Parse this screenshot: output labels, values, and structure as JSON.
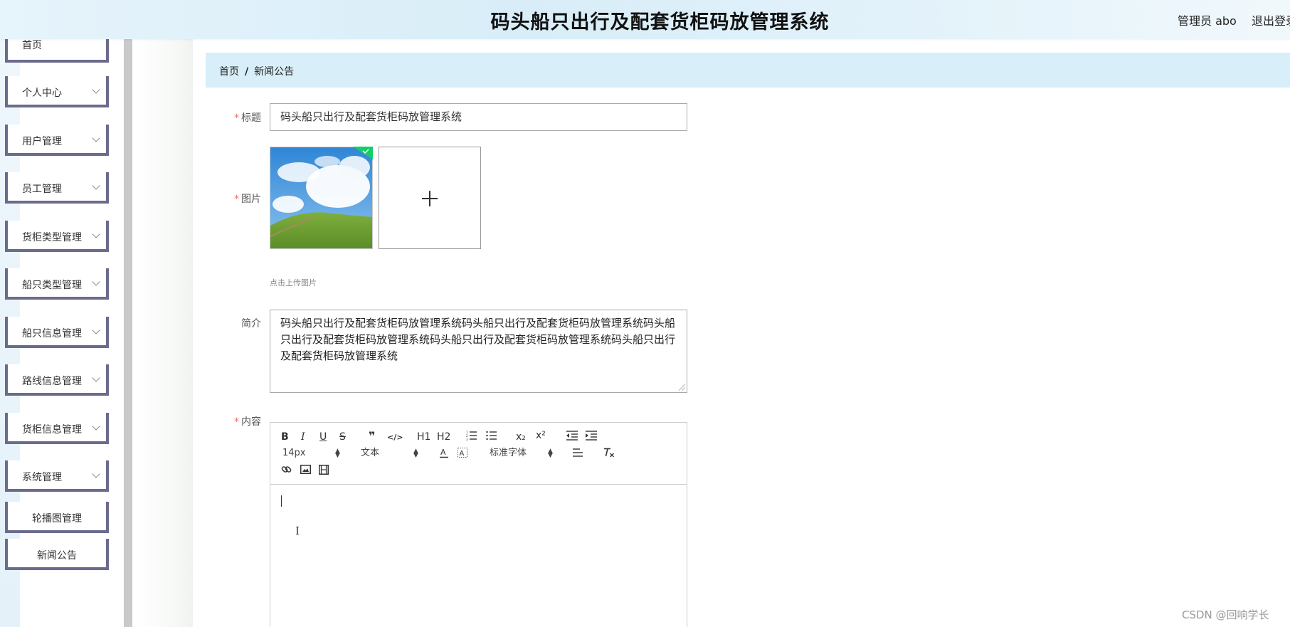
{
  "header": {
    "title": "码头船只出行及配套货柜码放管理系统",
    "admin_label": "管理员 abo",
    "logout_label": "退出登录"
  },
  "sidebar": {
    "items": [
      {
        "label": "首页",
        "expandable": false
      },
      {
        "label": "个人中心",
        "expandable": true
      },
      {
        "label": "用户管理",
        "expandable": true
      },
      {
        "label": "员工管理",
        "expandable": true
      },
      {
        "label": "货柜类型管理",
        "expandable": true
      },
      {
        "label": "船只类型管理",
        "expandable": true
      },
      {
        "label": "船只信息管理",
        "expandable": true
      },
      {
        "label": "路线信息管理",
        "expandable": true
      },
      {
        "label": "货柜信息管理",
        "expandable": true
      },
      {
        "label": "系统管理",
        "expandable": true
      },
      {
        "label": "轮播图管理",
        "expandable": false
      },
      {
        "label": "新闻公告",
        "expandable": false
      }
    ]
  },
  "breadcrumb": {
    "home": "首页",
    "separator": "/",
    "current": "新闻公告"
  },
  "form": {
    "title_label": "标题",
    "title_value": "码头船只出行及配套货柜码放管理系统",
    "image_label": "图片",
    "upload_hint": "点击上传图片",
    "intro_label": "简介",
    "intro_value": "码头船只出行及配套货柜码放管理系统码头船只出行及配套货柜码放管理系统码头船只出行及配套货柜码放管理系统码头船只出行及配套货柜码放管理系统码头船只出行及配套货柜码放管理系统",
    "content_label": "内容",
    "required_mark": "*"
  },
  "editor": {
    "toolbar": {
      "bold": "B",
      "italic": "I",
      "underline": "U",
      "strike": "S",
      "blockquote": "❞",
      "code": "</>",
      "h1": "H1",
      "h2": "H2",
      "subscript": "x₂",
      "superscript": "x²",
      "font_size": "14px",
      "text_style": "文本",
      "font_family": "标准字体"
    }
  },
  "colors": {
    "header_bg": "#dbeef8",
    "breadcrumb_bg": "#d8effa",
    "menu_border": "#6b6b8e",
    "required": "#f56c6c",
    "check_badge": "#13ce66"
  },
  "watermark": "CSDN @回响学长"
}
